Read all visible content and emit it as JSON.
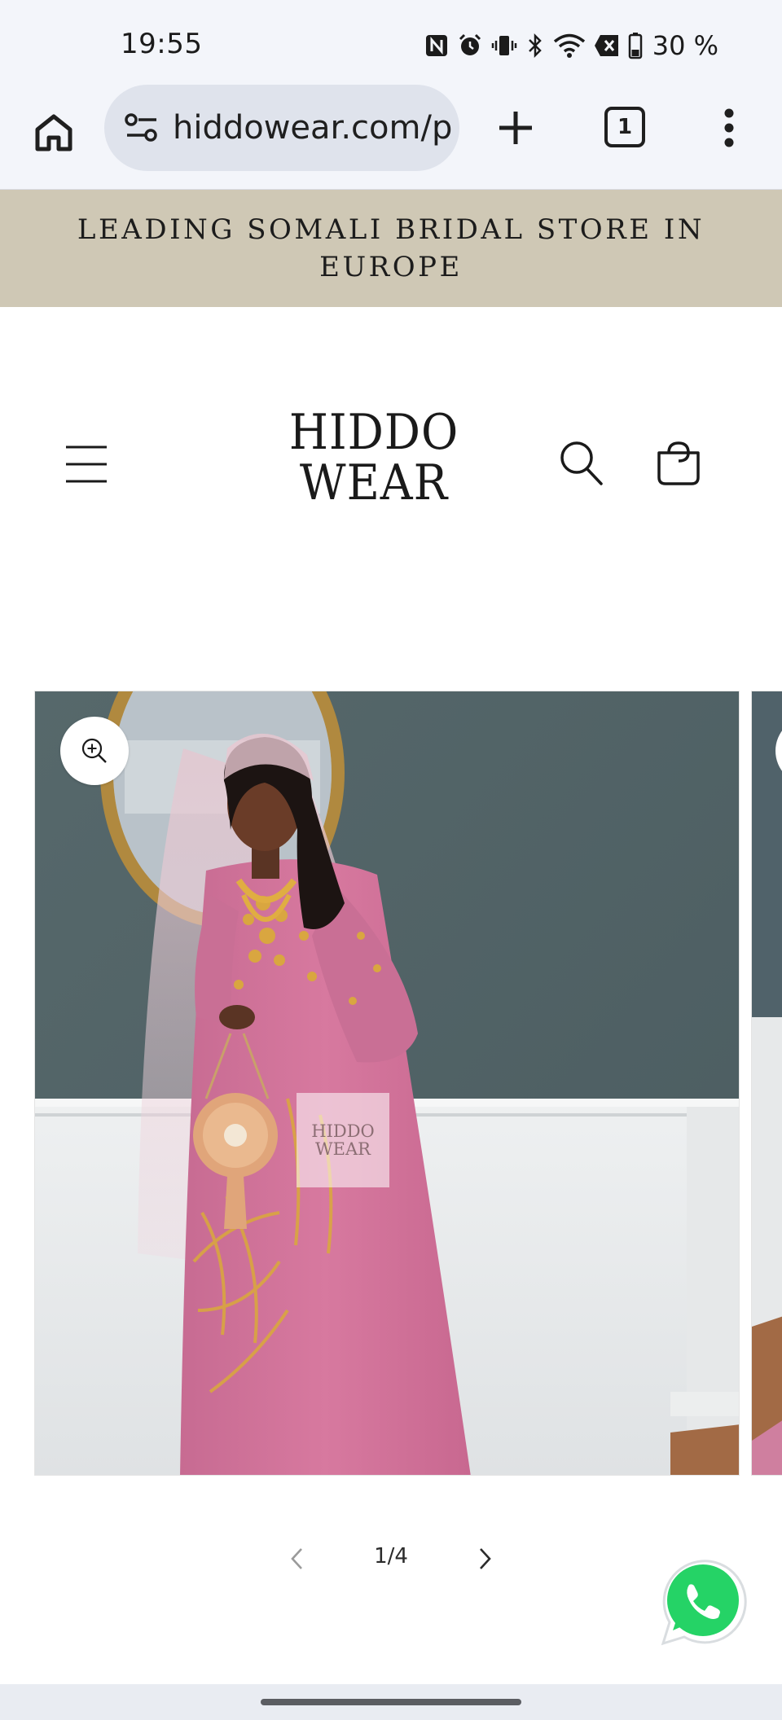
{
  "status_bar": {
    "time": "19:55",
    "battery": "30 %",
    "icons": [
      "nfc-icon",
      "alarm-icon",
      "vibrate-icon",
      "bluetooth-icon",
      "wifi-icon",
      "data-off-icon",
      "battery-icon"
    ]
  },
  "browser": {
    "url": "hiddowear.com/p",
    "tab_count": "1",
    "icons": [
      "home-icon",
      "site-settings-icon",
      "plus-icon",
      "more-vert-icon"
    ]
  },
  "announcement": {
    "text": "LEADING SOMALI BRIDAL STORE IN EUROPE",
    "background": "#cfc8b5"
  },
  "header": {
    "logo_line1": "HIDDO",
    "logo_line2": "WEAR",
    "icons": [
      "hamburger-menu-icon",
      "search-icon",
      "cart-icon"
    ]
  },
  "gallery": {
    "watermark_line1": "HIDDO",
    "watermark_line2": "WEAR",
    "counter": "1/4",
    "icons": [
      "zoom-in-icon",
      "chevron-left-icon",
      "chevron-right-icon"
    ]
  },
  "floating": {
    "icons": [
      "whatsapp-icon"
    ],
    "accent": "#25d366"
  }
}
